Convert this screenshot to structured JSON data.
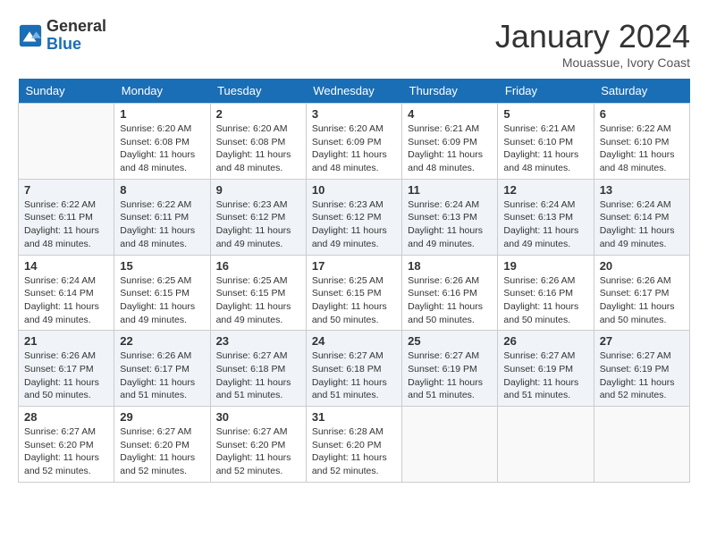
{
  "header": {
    "logo_general": "General",
    "logo_blue": "Blue",
    "month_title": "January 2024",
    "location": "Mouassue, Ivory Coast"
  },
  "days_of_week": [
    "Sunday",
    "Monday",
    "Tuesday",
    "Wednesday",
    "Thursday",
    "Friday",
    "Saturday"
  ],
  "weeks": [
    [
      {
        "day": "",
        "sunrise": "",
        "sunset": "",
        "daylight": ""
      },
      {
        "day": "1",
        "sunrise": "Sunrise: 6:20 AM",
        "sunset": "Sunset: 6:08 PM",
        "daylight": "Daylight: 11 hours and 48 minutes."
      },
      {
        "day": "2",
        "sunrise": "Sunrise: 6:20 AM",
        "sunset": "Sunset: 6:08 PM",
        "daylight": "Daylight: 11 hours and 48 minutes."
      },
      {
        "day": "3",
        "sunrise": "Sunrise: 6:20 AM",
        "sunset": "Sunset: 6:09 PM",
        "daylight": "Daylight: 11 hours and 48 minutes."
      },
      {
        "day": "4",
        "sunrise": "Sunrise: 6:21 AM",
        "sunset": "Sunset: 6:09 PM",
        "daylight": "Daylight: 11 hours and 48 minutes."
      },
      {
        "day": "5",
        "sunrise": "Sunrise: 6:21 AM",
        "sunset": "Sunset: 6:10 PM",
        "daylight": "Daylight: 11 hours and 48 minutes."
      },
      {
        "day": "6",
        "sunrise": "Sunrise: 6:22 AM",
        "sunset": "Sunset: 6:10 PM",
        "daylight": "Daylight: 11 hours and 48 minutes."
      }
    ],
    [
      {
        "day": "7",
        "sunrise": "Sunrise: 6:22 AM",
        "sunset": "Sunset: 6:11 PM",
        "daylight": "Daylight: 11 hours and 48 minutes."
      },
      {
        "day": "8",
        "sunrise": "Sunrise: 6:22 AM",
        "sunset": "Sunset: 6:11 PM",
        "daylight": "Daylight: 11 hours and 48 minutes."
      },
      {
        "day": "9",
        "sunrise": "Sunrise: 6:23 AM",
        "sunset": "Sunset: 6:12 PM",
        "daylight": "Daylight: 11 hours and 49 minutes."
      },
      {
        "day": "10",
        "sunrise": "Sunrise: 6:23 AM",
        "sunset": "Sunset: 6:12 PM",
        "daylight": "Daylight: 11 hours and 49 minutes."
      },
      {
        "day": "11",
        "sunrise": "Sunrise: 6:24 AM",
        "sunset": "Sunset: 6:13 PM",
        "daylight": "Daylight: 11 hours and 49 minutes."
      },
      {
        "day": "12",
        "sunrise": "Sunrise: 6:24 AM",
        "sunset": "Sunset: 6:13 PM",
        "daylight": "Daylight: 11 hours and 49 minutes."
      },
      {
        "day": "13",
        "sunrise": "Sunrise: 6:24 AM",
        "sunset": "Sunset: 6:14 PM",
        "daylight": "Daylight: 11 hours and 49 minutes."
      }
    ],
    [
      {
        "day": "14",
        "sunrise": "Sunrise: 6:24 AM",
        "sunset": "Sunset: 6:14 PM",
        "daylight": "Daylight: 11 hours and 49 minutes."
      },
      {
        "day": "15",
        "sunrise": "Sunrise: 6:25 AM",
        "sunset": "Sunset: 6:15 PM",
        "daylight": "Daylight: 11 hours and 49 minutes."
      },
      {
        "day": "16",
        "sunrise": "Sunrise: 6:25 AM",
        "sunset": "Sunset: 6:15 PM",
        "daylight": "Daylight: 11 hours and 49 minutes."
      },
      {
        "day": "17",
        "sunrise": "Sunrise: 6:25 AM",
        "sunset": "Sunset: 6:15 PM",
        "daylight": "Daylight: 11 hours and 50 minutes."
      },
      {
        "day": "18",
        "sunrise": "Sunrise: 6:26 AM",
        "sunset": "Sunset: 6:16 PM",
        "daylight": "Daylight: 11 hours and 50 minutes."
      },
      {
        "day": "19",
        "sunrise": "Sunrise: 6:26 AM",
        "sunset": "Sunset: 6:16 PM",
        "daylight": "Daylight: 11 hours and 50 minutes."
      },
      {
        "day": "20",
        "sunrise": "Sunrise: 6:26 AM",
        "sunset": "Sunset: 6:17 PM",
        "daylight": "Daylight: 11 hours and 50 minutes."
      }
    ],
    [
      {
        "day": "21",
        "sunrise": "Sunrise: 6:26 AM",
        "sunset": "Sunset: 6:17 PM",
        "daylight": "Daylight: 11 hours and 50 minutes."
      },
      {
        "day": "22",
        "sunrise": "Sunrise: 6:26 AM",
        "sunset": "Sunset: 6:17 PM",
        "daylight": "Daylight: 11 hours and 51 minutes."
      },
      {
        "day": "23",
        "sunrise": "Sunrise: 6:27 AM",
        "sunset": "Sunset: 6:18 PM",
        "daylight": "Daylight: 11 hours and 51 minutes."
      },
      {
        "day": "24",
        "sunrise": "Sunrise: 6:27 AM",
        "sunset": "Sunset: 6:18 PM",
        "daylight": "Daylight: 11 hours and 51 minutes."
      },
      {
        "day": "25",
        "sunrise": "Sunrise: 6:27 AM",
        "sunset": "Sunset: 6:19 PM",
        "daylight": "Daylight: 11 hours and 51 minutes."
      },
      {
        "day": "26",
        "sunrise": "Sunrise: 6:27 AM",
        "sunset": "Sunset: 6:19 PM",
        "daylight": "Daylight: 11 hours and 51 minutes."
      },
      {
        "day": "27",
        "sunrise": "Sunrise: 6:27 AM",
        "sunset": "Sunset: 6:19 PM",
        "daylight": "Daylight: 11 hours and 52 minutes."
      }
    ],
    [
      {
        "day": "28",
        "sunrise": "Sunrise: 6:27 AM",
        "sunset": "Sunset: 6:20 PM",
        "daylight": "Daylight: 11 hours and 52 minutes."
      },
      {
        "day": "29",
        "sunrise": "Sunrise: 6:27 AM",
        "sunset": "Sunset: 6:20 PM",
        "daylight": "Daylight: 11 hours and 52 minutes."
      },
      {
        "day": "30",
        "sunrise": "Sunrise: 6:27 AM",
        "sunset": "Sunset: 6:20 PM",
        "daylight": "Daylight: 11 hours and 52 minutes."
      },
      {
        "day": "31",
        "sunrise": "Sunrise: 6:28 AM",
        "sunset": "Sunset: 6:20 PM",
        "daylight": "Daylight: 11 hours and 52 minutes."
      },
      {
        "day": "",
        "sunrise": "",
        "sunset": "",
        "daylight": ""
      },
      {
        "day": "",
        "sunrise": "",
        "sunset": "",
        "daylight": ""
      },
      {
        "day": "",
        "sunrise": "",
        "sunset": "",
        "daylight": ""
      }
    ]
  ]
}
